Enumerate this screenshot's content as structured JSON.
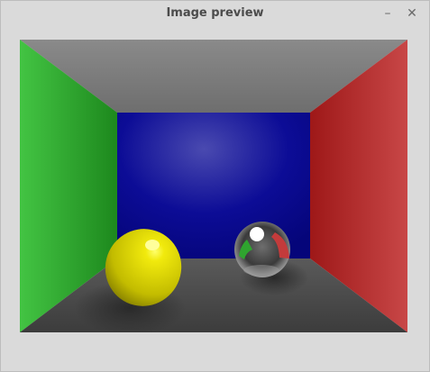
{
  "window": {
    "title": "Image preview",
    "minimize_glyph": "–",
    "close_glyph": "✕"
  },
  "preview": {
    "icon_minimize": "minimize-icon",
    "icon_close": "close-icon",
    "colors": {
      "left_wall": "#33a833",
      "right_wall": "#b52626",
      "back_wall": "#0d0d8e",
      "ceiling": "#7a7a7a",
      "floor": "#4a4a4a",
      "yellow_ellipsoid": "#d8d000",
      "chrome_sphere": "#9a9a9a"
    }
  }
}
